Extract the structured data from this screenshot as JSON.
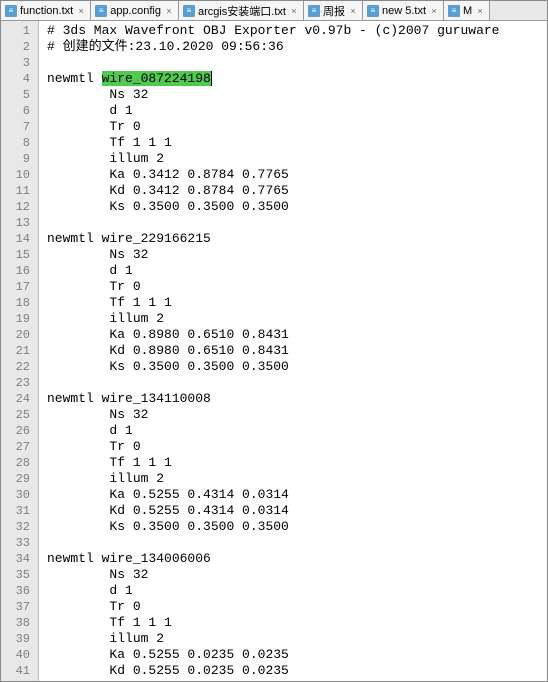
{
  "tabs": [
    {
      "label": "function.txt"
    },
    {
      "label": "app.config"
    },
    {
      "label": "arcgis安装端口.txt"
    },
    {
      "label": "周报"
    },
    {
      "label": "new 5.txt"
    },
    {
      "label": "M"
    }
  ],
  "lines": [
    {
      "n": 1,
      "t": "# 3ds Max Wavefront OBJ Exporter v0.97b - (c)2007 guruware"
    },
    {
      "n": 2,
      "t": "# 创建的文件:23.10.2020 09:56:36"
    },
    {
      "n": 3,
      "t": ""
    },
    {
      "n": 4,
      "pre": "newmtl ",
      "hl": "wire_087224198",
      "caret": true
    },
    {
      "n": 5,
      "t": "\tNs 32"
    },
    {
      "n": 6,
      "t": "\td 1"
    },
    {
      "n": 7,
      "t": "\tTr 0"
    },
    {
      "n": 8,
      "t": "\tTf 1 1 1"
    },
    {
      "n": 9,
      "t": "\tillum 2"
    },
    {
      "n": 10,
      "t": "\tKa 0.3412 0.8784 0.7765"
    },
    {
      "n": 11,
      "t": "\tKd 0.3412 0.8784 0.7765"
    },
    {
      "n": 12,
      "t": "\tKs 0.3500 0.3500 0.3500"
    },
    {
      "n": 13,
      "t": ""
    },
    {
      "n": 14,
      "t": "newmtl wire_229166215"
    },
    {
      "n": 15,
      "t": "\tNs 32"
    },
    {
      "n": 16,
      "t": "\td 1"
    },
    {
      "n": 17,
      "t": "\tTr 0"
    },
    {
      "n": 18,
      "t": "\tTf 1 1 1"
    },
    {
      "n": 19,
      "t": "\tillum 2"
    },
    {
      "n": 20,
      "t": "\tKa 0.8980 0.6510 0.8431"
    },
    {
      "n": 21,
      "t": "\tKd 0.8980 0.6510 0.8431"
    },
    {
      "n": 22,
      "t": "\tKs 0.3500 0.3500 0.3500"
    },
    {
      "n": 23,
      "t": ""
    },
    {
      "n": 24,
      "t": "newmtl wire_134110008"
    },
    {
      "n": 25,
      "t": "\tNs 32"
    },
    {
      "n": 26,
      "t": "\td 1"
    },
    {
      "n": 27,
      "t": "\tTr 0"
    },
    {
      "n": 28,
      "t": "\tTf 1 1 1"
    },
    {
      "n": 29,
      "t": "\tillum 2"
    },
    {
      "n": 30,
      "t": "\tKa 0.5255 0.4314 0.0314"
    },
    {
      "n": 31,
      "t": "\tKd 0.5255 0.4314 0.0314"
    },
    {
      "n": 32,
      "t": "\tKs 0.3500 0.3500 0.3500"
    },
    {
      "n": 33,
      "t": ""
    },
    {
      "n": 34,
      "t": "newmtl wire_134006006"
    },
    {
      "n": 35,
      "t": "\tNs 32"
    },
    {
      "n": 36,
      "t": "\td 1"
    },
    {
      "n": 37,
      "t": "\tTr 0"
    },
    {
      "n": 38,
      "t": "\tTf 1 1 1"
    },
    {
      "n": 39,
      "t": "\tillum 2"
    },
    {
      "n": 40,
      "t": "\tKa 0.5255 0.0235 0.0235"
    },
    {
      "n": 41,
      "t": "\tKd 0.5255 0.0235 0.0235"
    }
  ]
}
